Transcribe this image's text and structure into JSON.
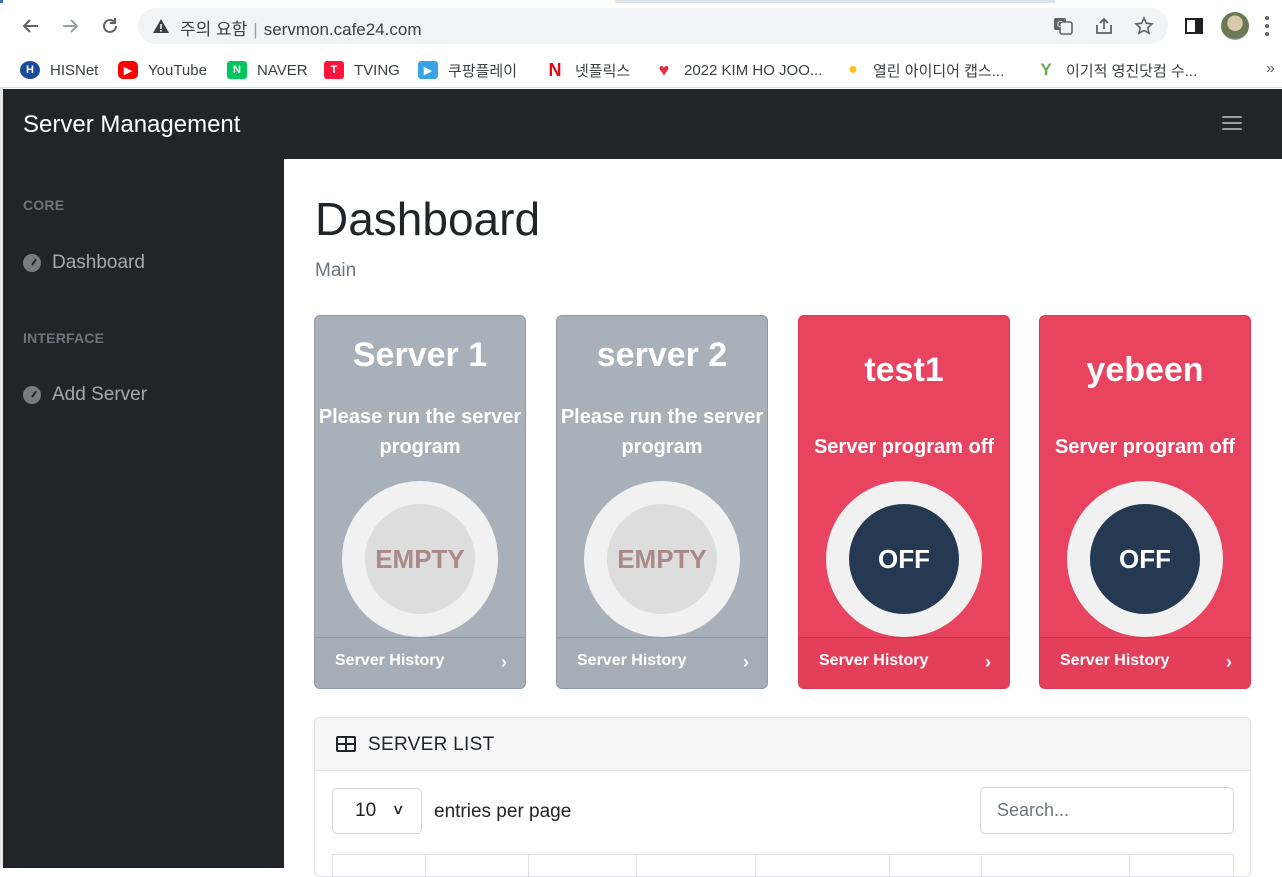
{
  "browser": {
    "security_label": "주의 요함",
    "url": "servmon.cafe24.com",
    "bookmarks": [
      {
        "label": "HISNet",
        "icon": "hisnet-icon",
        "color": "#1a4b9a"
      },
      {
        "label": "YouTube",
        "icon": "youtube-icon",
        "color": "#ff0000"
      },
      {
        "label": "NAVER",
        "icon": "naver-icon",
        "color": "#03c75a"
      },
      {
        "label": "TVING",
        "icon": "tving-icon",
        "color": "#ff153c"
      },
      {
        "label": "쿠팡플레이",
        "icon": "coupang-play-icon",
        "color": "#3aa3e8"
      },
      {
        "label": "넷플릭스",
        "icon": "netflix-icon",
        "color": "#e50914"
      },
      {
        "label": "2022 KIM HO JOO...",
        "icon": "heart-icon",
        "color": "#e2304a"
      },
      {
        "label": "열린 아이디어 캡스...",
        "icon": "lightbulb-icon",
        "color": "#f5c518"
      },
      {
        "label": "이기적 영진닷컴 수...",
        "icon": "yeongjin-icon",
        "color": "#6aa84f"
      }
    ],
    "more_label": "»"
  },
  "app": {
    "brand": "Server Management",
    "sidebar": {
      "core_heading": "CORE",
      "dashboard_link": "Dashboard",
      "interface_heading": "INTERFACE",
      "add_server_link": "Add Server"
    },
    "page_title": "Dashboard",
    "page_subtitle": "Main",
    "cards": [
      {
        "name": "Server 1",
        "message": "Please run the server program",
        "status": "EMPTY",
        "footer": "Server History",
        "chevron": "›",
        "theme": "#a8b0ba"
      },
      {
        "name": "server 2",
        "message": "Please run the server program",
        "status": "EMPTY",
        "footer": "Server History",
        "chevron": "›",
        "theme": "#a8b0ba"
      },
      {
        "name": "test1",
        "message": "Server program off",
        "status": "OFF",
        "footer": "Server History",
        "chevron": "›",
        "theme": "#e84460"
      },
      {
        "name": "yebeen",
        "message": "Server program off",
        "status": "OFF",
        "footer": "Server History",
        "chevron": "›",
        "theme": "#e84460"
      }
    ],
    "table": {
      "title": "SERVER LIST",
      "per_page_value": "10",
      "per_page_label": "entries per page",
      "search_placeholder": "Search..."
    }
  }
}
